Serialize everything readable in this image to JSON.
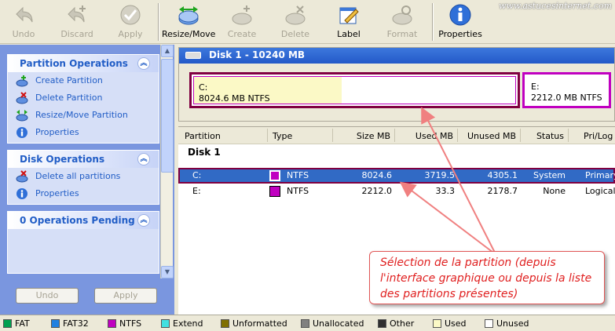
{
  "toolbar": {
    "buttons": [
      {
        "label": "Undo",
        "icon": "undo-icon",
        "enabled": false
      },
      {
        "label": "Discard",
        "icon": "discard-icon",
        "enabled": false
      },
      {
        "label": "Apply",
        "icon": "apply-icon",
        "enabled": false
      },
      {
        "label": "Resize/Move",
        "icon": "resize-move-icon",
        "enabled": true
      },
      {
        "label": "Create",
        "icon": "create-icon",
        "enabled": false
      },
      {
        "label": "Delete",
        "icon": "delete-icon",
        "enabled": false
      },
      {
        "label": "Label",
        "icon": "label-icon",
        "enabled": true
      },
      {
        "label": "Format",
        "icon": "format-icon",
        "enabled": false
      },
      {
        "label": "Properties",
        "icon": "properties-icon",
        "enabled": true
      }
    ],
    "watermark": "www.astucesinternet.com"
  },
  "sidebar": {
    "partition_ops": {
      "title": "Partition Operations",
      "items": [
        {
          "label": "Create Partition",
          "icon": "create-partition-icon"
        },
        {
          "label": "Delete Partition",
          "icon": "delete-partition-icon"
        },
        {
          "label": "Resize/Move Partition",
          "icon": "resize-partition-icon"
        },
        {
          "label": "Properties",
          "icon": "info-icon"
        }
      ]
    },
    "disk_ops": {
      "title": "Disk Operations",
      "items": [
        {
          "label": "Delete all partitions",
          "icon": "delete-all-icon"
        },
        {
          "label": "Properties",
          "icon": "info-icon"
        }
      ]
    },
    "pending": {
      "title": "0 Operations Pending"
    },
    "undo_label": "Undo",
    "apply_label": "Apply"
  },
  "diskmap": {
    "title": "Disk 1 - 10240 MB",
    "partitions": [
      {
        "name": "C:",
        "detail": "8024.6 MB  NTFS",
        "used_fraction": 0.46
      },
      {
        "name": "E:",
        "detail": "2212.0 MB  NTFS",
        "used_fraction": 0.0
      }
    ]
  },
  "table": {
    "columns": [
      "Partition",
      "Type",
      "Size MB",
      "Used MB",
      "Unused MB",
      "Status",
      "Pri/Log"
    ],
    "disk_label": "Disk 1",
    "rows": [
      {
        "partition": "C:",
        "type": "NTFS",
        "size": "8024.6",
        "used": "3719.5",
        "unused": "4305.1",
        "status": "System",
        "prilog": "Primary",
        "selected": true
      },
      {
        "partition": "E:",
        "type": "NTFS",
        "size": "2212.0",
        "used": "33.3",
        "unused": "2178.7",
        "status": "None",
        "prilog": "Logical",
        "selected": false
      }
    ]
  },
  "legend": [
    {
      "label": "FAT",
      "color": "#00a050"
    },
    {
      "label": "FAT32",
      "color": "#2080e0"
    },
    {
      "label": "NTFS",
      "color": "#c000c0"
    },
    {
      "label": "Extend",
      "color": "#40e0e0"
    },
    {
      "label": "Unformatted",
      "color": "#807000"
    },
    {
      "label": "Unallocated",
      "color": "#808080"
    },
    {
      "label": "Other",
      "color": "#303030"
    },
    {
      "label": "Used",
      "color": "#fbf9c6"
    },
    {
      "label": "Unused",
      "color": "#ffffff"
    }
  ],
  "colors": {
    "ntfs": "#c000c0",
    "selection_border": "#800040",
    "selection_row": "#316ac5"
  },
  "annotation": {
    "lines": [
      "Sélection de la partition (depuis",
      "l'interface graphique ou depuis la liste",
      "des partitions présentes)"
    ]
  }
}
